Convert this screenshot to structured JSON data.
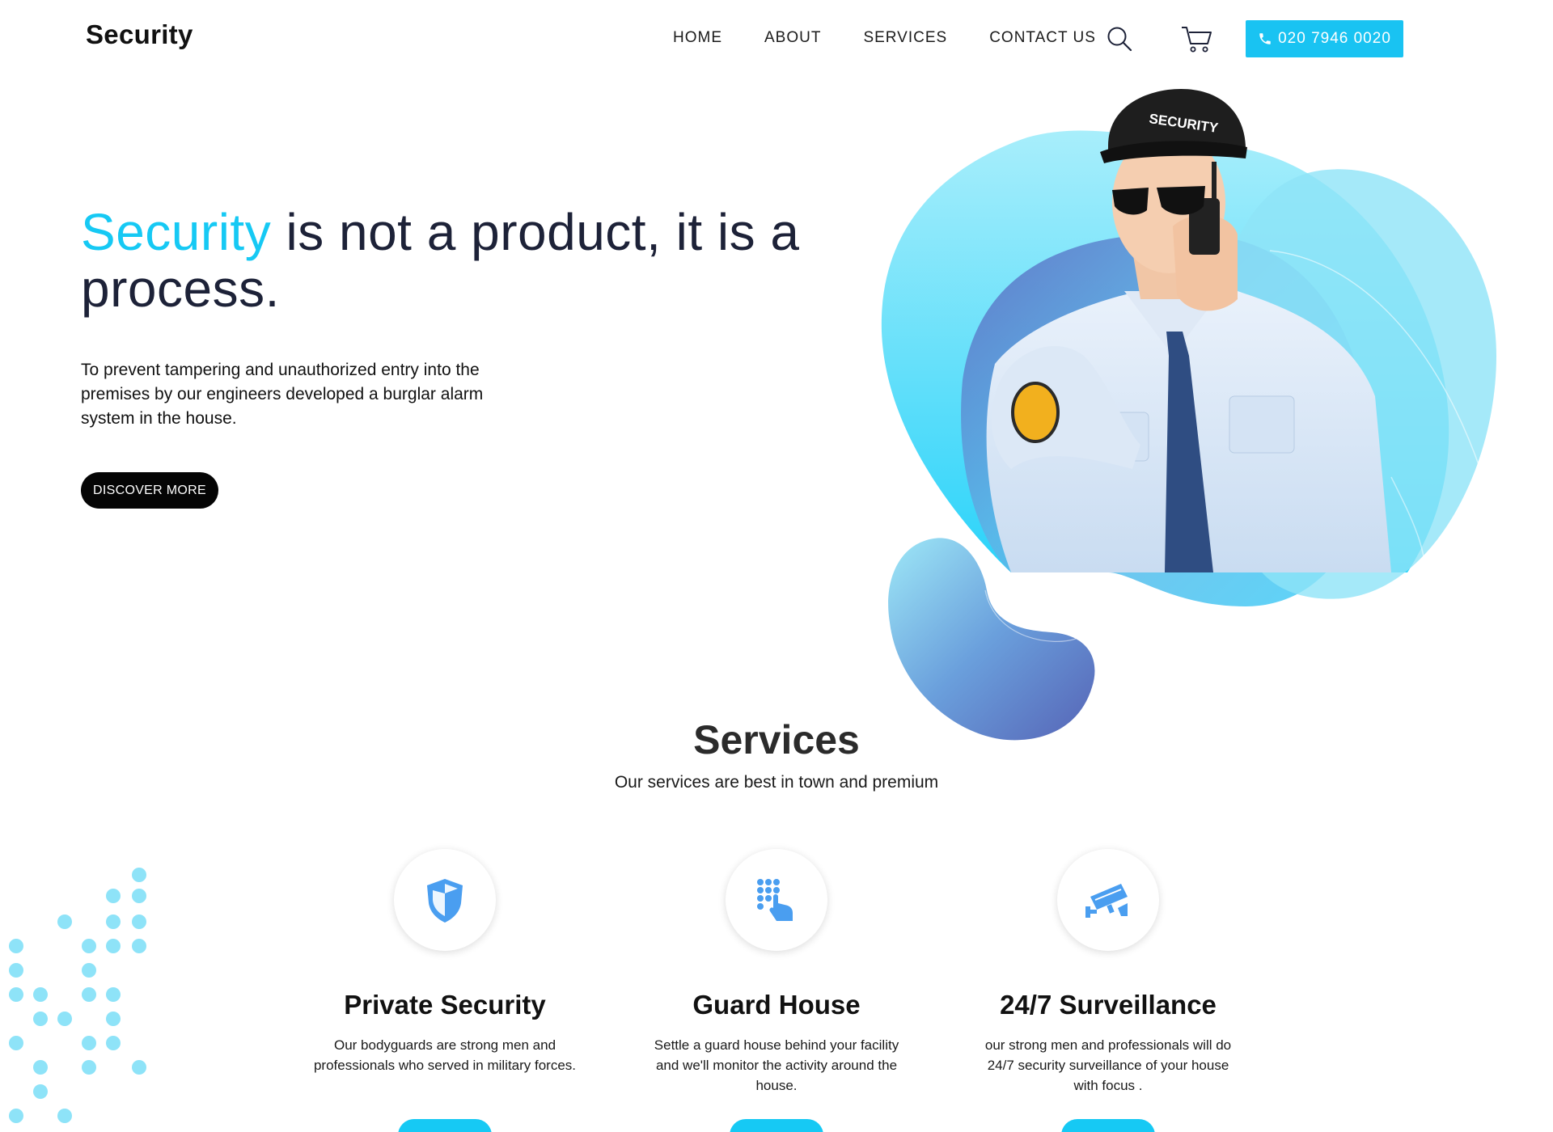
{
  "header": {
    "logo": "Security",
    "nav": [
      "HOME",
      "ABOUT",
      "SERVICES",
      "CONTACT US"
    ],
    "phone": "020 7946 0020",
    "icons": {
      "search": "search-icon",
      "cart": "cart-icon",
      "phone": "phone-icon"
    }
  },
  "hero": {
    "title_accent": "Security",
    "title_rest": " is not a product, it is a process.",
    "description": "To prevent tampering and unauthorized entry into the premises by our engineers developed a burglar alarm system in the house.",
    "button": "DISCOVER MORE",
    "badge_text": "SECURITY"
  },
  "services": {
    "title": "Services",
    "subtitle": "Our services are best in town and premium",
    "items": [
      {
        "title": "Private Security",
        "description": "Our bodyguards are strong men and professionals who served in military forces.",
        "icon": "shield-icon"
      },
      {
        "title": "Guard House",
        "description": "Settle a guard house behind your facility and we'll monitor the activity around the house.",
        "icon": "keypad-icon"
      },
      {
        "title": "24/7 Surveillance",
        "description": "our strong men and professionals will do 24/7 security surveillance of your house with focus .",
        "icon": "cctv-camera-icon"
      }
    ]
  },
  "colors": {
    "accent": "#16c9f4",
    "dark": "#1d2238",
    "button_dark": "#050505",
    "icon_blue": "#4a9ef0",
    "dot": "#8ee3f8"
  }
}
